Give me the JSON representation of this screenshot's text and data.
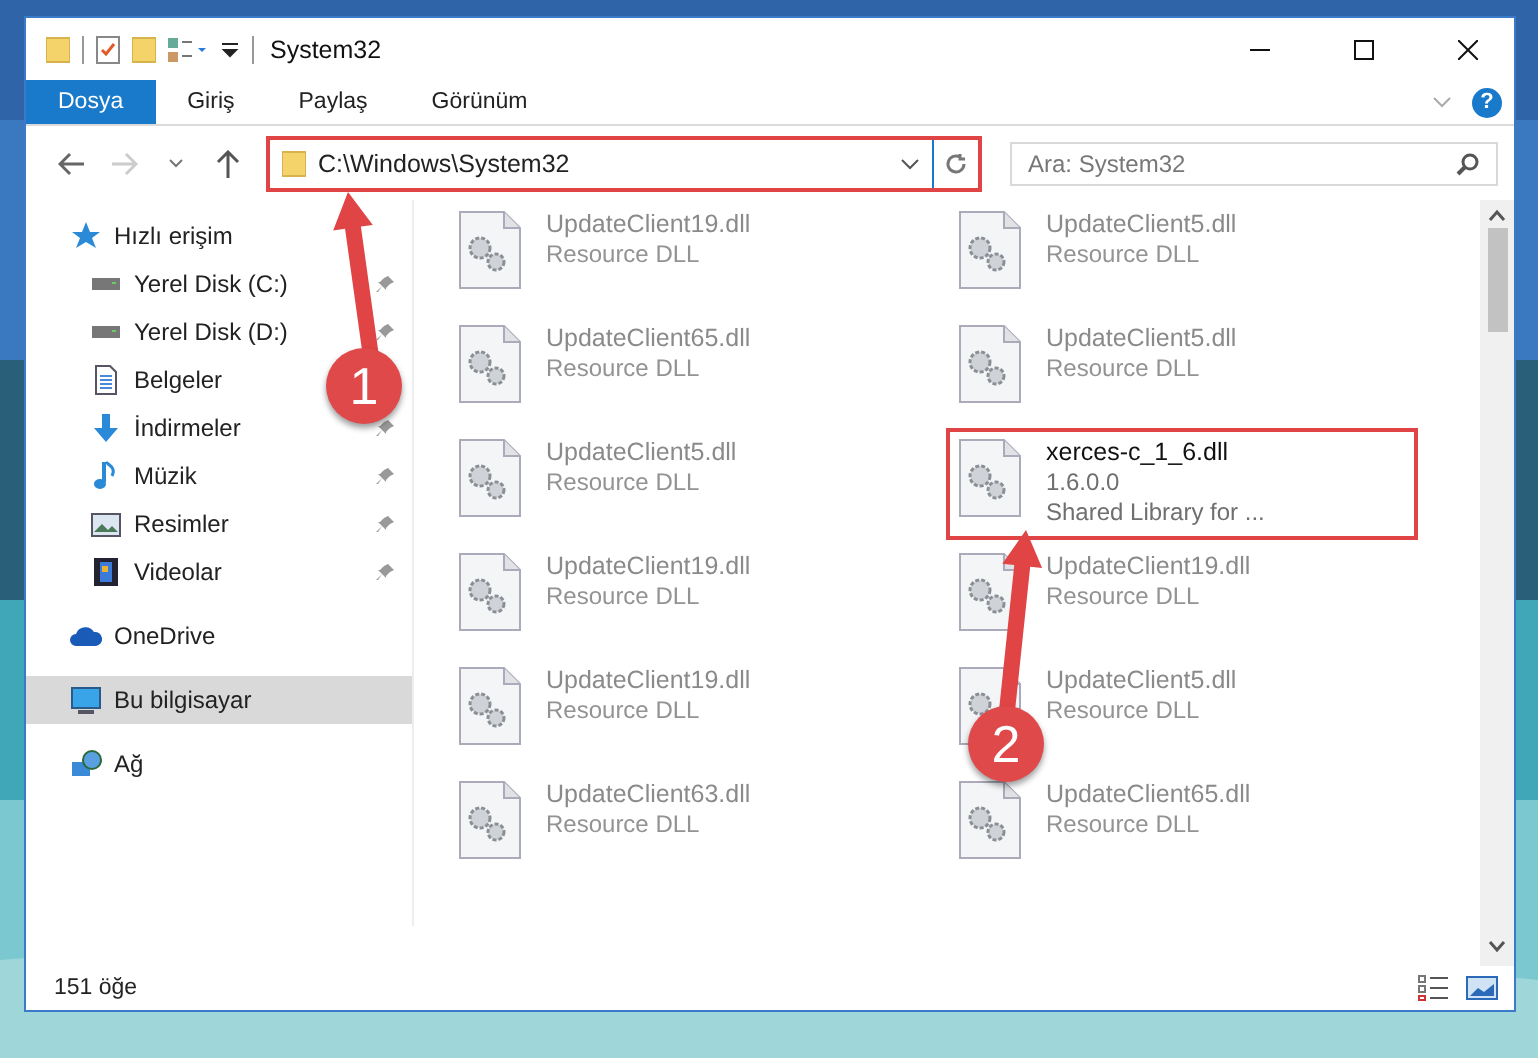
{
  "window": {
    "title": "System32"
  },
  "ribbon": {
    "help": "?",
    "tabs": [
      {
        "label": "Dosya",
        "selected": true
      },
      {
        "label": "Giriş",
        "selected": false
      },
      {
        "label": "Paylaş",
        "selected": false
      },
      {
        "label": "Görünüm",
        "selected": false
      }
    ]
  },
  "address_bar": {
    "path": "C:\\Windows\\System32",
    "highlighted": true,
    "search": {
      "placeholder": "Ara: System32"
    }
  },
  "sidebar": {
    "items": [
      {
        "label": "Hızlı erişim",
        "kind": "star",
        "selected": false,
        "children": [
          {
            "label": "Yerel Disk (C:)",
            "kind": "drive",
            "pinned": true,
            "selected": false
          },
          {
            "label": "Yerel Disk (D:)",
            "kind": "drive",
            "pinned": true,
            "selected": false
          },
          {
            "label": "Belgeler",
            "kind": "document",
            "pinned": false,
            "selected": false
          },
          {
            "label": "İndirmeler",
            "kind": "download",
            "pinned": true,
            "selected": false
          },
          {
            "label": "Müzik",
            "kind": "music",
            "pinned": true,
            "selected": false
          },
          {
            "label": "Resimler",
            "pinned": true,
            "selected": false
          },
          {
            "label": "Videolar",
            "kind": "video",
            "pinned": true,
            "selected": false
          }
        ]
      },
      {
        "label": "OneDrive",
        "kind": "cloud",
        "selected": false
      },
      {
        "label": "Bu bilgisayar",
        "kind": "computer",
        "selected": true
      },
      {
        "label": "Ağ",
        "kind": "network",
        "selected": false
      }
    ]
  },
  "files": [
    {
      "name": "UpdateClient19.dll",
      "details": [
        "Resource DLL"
      ],
      "highlighted": false
    },
    {
      "name": "UpdateClient5.dll",
      "details": [
        "Resource DLL"
      ],
      "highlighted": false
    },
    {
      "name": "UpdateClient65.dll",
      "details": [
        "Resource DLL"
      ],
      "highlighted": false
    },
    {
      "name": "UpdateClient5.dll",
      "details": [
        "Resource DLL"
      ],
      "highlighted": false
    },
    {
      "name": "UpdateClient5.dll",
      "details": [
        "Resource DLL"
      ],
      "highlighted": false
    },
    {
      "name": "xerces-c_1_6.dll",
      "details": [
        "1.6.0.0",
        "Shared Library for ..."
      ],
      "highlighted": true
    },
    {
      "name": "UpdateClient19.dll",
      "details": [
        "Resource DLL"
      ],
      "highlighted": false
    },
    {
      "name": "UpdateClient19.dll",
      "details": [
        "Resource DLL"
      ],
      "highlighted": false
    },
    {
      "name": "UpdateClient19.dll",
      "details": [
        "Resource DLL"
      ],
      "highlighted": false
    },
    {
      "name": "UpdateClient5.dll",
      "details": [
        "Resource DLL"
      ],
      "highlighted": false
    },
    {
      "name": "UpdateClient63.dll",
      "details": [
        "Resource DLL"
      ],
      "highlighted": false
    },
    {
      "name": "UpdateClient65.dll",
      "details": [
        "Resource DLL"
      ],
      "highlighted": false
    }
  ],
  "status_bar": {
    "count": "151 öğe"
  },
  "annotations": [
    {
      "number": "1"
    },
    {
      "number": "2"
    }
  ]
}
